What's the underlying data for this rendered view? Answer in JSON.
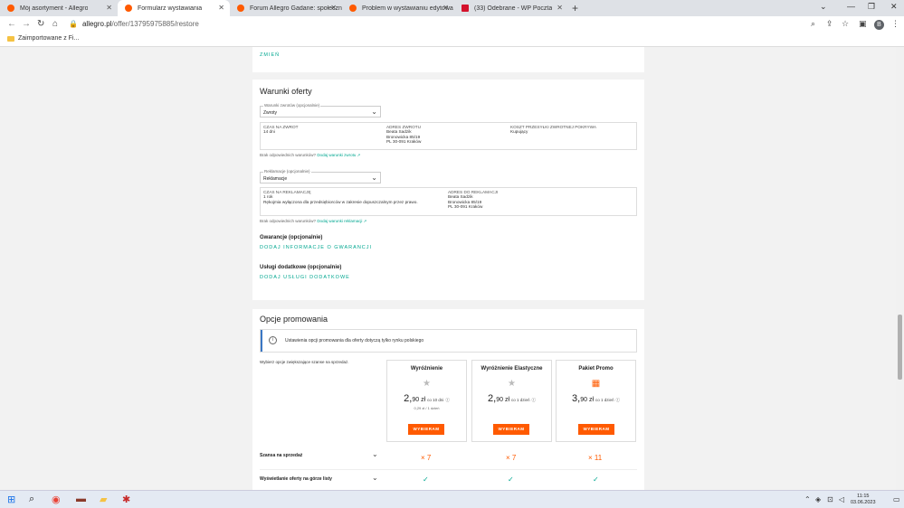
{
  "browser": {
    "tabs": [
      {
        "label": "Mój asortyment - Allegro",
        "color": "#ff5a00"
      },
      {
        "label": "Formularz wystawiania",
        "color": "#ff5a00"
      },
      {
        "label": "Forum Allegro Gadane: społeczn",
        "color": "#ff5a00"
      },
      {
        "label": "Problem w wystawianiu edytowa",
        "color": "#ff5a00"
      },
      {
        "label": "(33) Odebrane - WP Poczta",
        "color": "#d4122c"
      }
    ],
    "url_host": "allegro.pl",
    "url_path": "/offer/13795975885/restore",
    "bookmark": "Zaimportowane z Fi...",
    "avatar_letter": "B"
  },
  "page": {
    "change_link": "ZMIEŃ",
    "conditions": {
      "title": "Warunki oferty",
      "returns": {
        "select_label": "Warunki zwrotów (opcjonalnie)",
        "select_value": "Zwroty",
        "col1_header": "CZAS NA ZWROT",
        "col1_lines": [
          "14 dni"
        ],
        "col2_header": "ADRES ZWROTU",
        "col2_lines": [
          "Beata Sadzik",
          "Bronowicka 85/19",
          "PL 30-091 Kraków"
        ],
        "col3_header": "KOSZT PRZESYŁKI ZWROTNEJ POKRYWA",
        "col3_lines": [
          "Kupujący"
        ],
        "note_text": "Brak odpowiednich warunków?",
        "note_link": "Dodaj warunki zwrotu ↗"
      },
      "complaints": {
        "select_label": "Reklamacje (opcjonalnie)",
        "select_value": "Reklamacje",
        "col1_header": "CZAS NA REKLAMACJĘ",
        "col1_lines": [
          "1 rok",
          "Rękojmia wyłączona dla przedsiębiorców w zakresie dopuszczalnym przez prawo."
        ],
        "col2_header": "ADRES DO REKLAMACJI",
        "col2_lines": [
          "Beata Sadzik",
          "Bronowicka 85/19",
          "PL 30-091 Kraków"
        ],
        "note_text": "Brak odpowiednich warunków?",
        "note_link": "Dodaj warunki reklamacji ↗"
      },
      "warranty_title": "Gwarancje (opcjonalnie)",
      "warranty_link": "DODAJ INFORMACJE O GWARANCJI",
      "services_title": "Usługi dodatkowe (opcjonalnie)",
      "services_link": "DODAJ USŁUGI DODATKOWE"
    },
    "promo": {
      "title": "Opcje promowania",
      "info": "Ustawienia opcji promowania dla oferty dotyczą tylko rynku polskiego",
      "choose_text": "Wybierz opcje zwiększające szanse na sprzedaż.",
      "packages": [
        {
          "name": "Wyróżnienie",
          "price_int": "2,",
          "price_dec": "90",
          "currency": "zł",
          "per": "co 10 dni",
          "sub": "0,29 zł / 1 dzień",
          "button": "WYBIERAM",
          "icon": "star-icon"
        },
        {
          "name": "Wyróżnienie Elastyczne",
          "price_int": "2,",
          "price_dec": "90",
          "currency": "zł",
          "per": "co 1 dzień",
          "sub": "",
          "button": "WYBIERAM",
          "icon": "star-icon"
        },
        {
          "name": "Pakiet Promo",
          "price_int": "3,",
          "price_dec": "90",
          "currency": "zł",
          "per": "co 1 dzień",
          "sub": "",
          "button": "WYBIERAM",
          "icon": "calendar-icon"
        }
      ],
      "rows": [
        {
          "label": "Szansa na sprzedaż",
          "values": [
            "× 7",
            "× 7",
            "× 11"
          ]
        },
        {
          "label": "Wyświetlanie oferty na górze listy",
          "values": [
            "✓",
            "✓",
            "✓"
          ]
        }
      ]
    }
  },
  "taskbar": {
    "time": "11:15",
    "date": "03.06.2023"
  }
}
